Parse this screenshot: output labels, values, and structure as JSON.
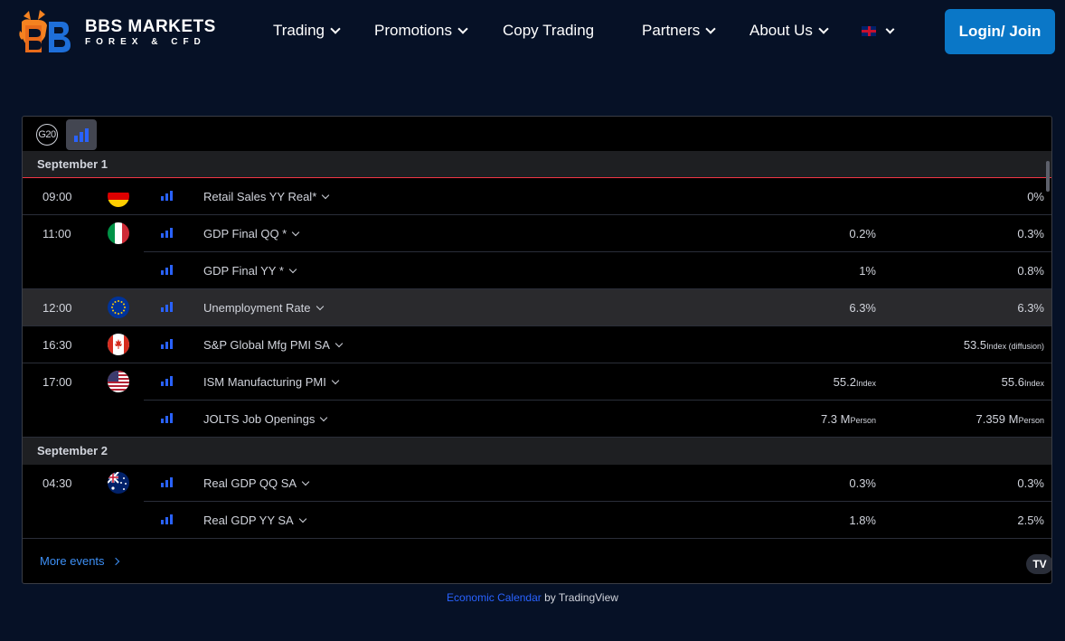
{
  "header": {
    "logo_title": "BBS MARKETS",
    "logo_subtitle": "FOREX & CFD",
    "nav": [
      {
        "label": "Trading",
        "dropdown": true
      },
      {
        "label": "Promotions",
        "dropdown": true
      },
      {
        "label": "Copy Trading",
        "dropdown": false
      },
      {
        "label": "Partners",
        "dropdown": true
      },
      {
        "label": "About Us",
        "dropdown": true
      }
    ],
    "language_icon": "uk-flag-icon",
    "login_label": "Login/ Join"
  },
  "widget": {
    "g20_label": "G20",
    "days": [
      {
        "date": "September 1",
        "events": [
          {
            "time": "09:00",
            "country": "germany",
            "title": "Retail Sales YY Real*",
            "forecast": "",
            "forecast_unit": "",
            "prior": "0%",
            "prior_unit": ""
          },
          {
            "time": "11:00",
            "country": "italy",
            "title": "GDP Final QQ *",
            "forecast": "0.2%",
            "forecast_unit": "",
            "prior": "0.3%",
            "prior_unit": ""
          },
          {
            "time": "",
            "country": "",
            "title": "GDP Final YY *",
            "forecast": "1%",
            "forecast_unit": "",
            "prior": "0.8%",
            "prior_unit": ""
          },
          {
            "time": "12:00",
            "country": "eu",
            "title": "Unemployment Rate",
            "forecast": "6.3%",
            "forecast_unit": "",
            "prior": "6.3%",
            "prior_unit": "",
            "highlight": true
          },
          {
            "time": "16:30",
            "country": "canada",
            "title": "S&P Global Mfg PMI SA",
            "forecast": "",
            "forecast_unit": "",
            "prior": "53.5",
            "prior_unit": "Index (diffusion)"
          },
          {
            "time": "17:00",
            "country": "usa",
            "title": "ISM Manufacturing PMI",
            "forecast": "55.2",
            "forecast_unit": "Index",
            "prior": "55.6",
            "prior_unit": "Index"
          },
          {
            "time": "",
            "country": "",
            "title": "JOLTS Job Openings",
            "forecast": "7.3 M",
            "forecast_unit": "Person",
            "prior": "7.359 M",
            "prior_unit": "Person"
          }
        ]
      },
      {
        "date": "September 2",
        "events": [
          {
            "time": "04:30",
            "country": "australia",
            "title": "Real GDP QQ SA",
            "forecast": "0.3%",
            "forecast_unit": "",
            "prior": "0.3%",
            "prior_unit": ""
          },
          {
            "time": "",
            "country": "",
            "title": "Real GDP YY SA",
            "forecast": "1.8%",
            "forecast_unit": "",
            "prior": "2.5%",
            "prior_unit": ""
          }
        ]
      }
    ],
    "more_events_label": "More events",
    "tv_logo": "TV"
  },
  "footer": {
    "link_label": "Economic Calendar",
    "suffix": " by TradingView"
  },
  "colors": {
    "background": "#061126",
    "login_button": "#0a77c7",
    "importance_bar": "#2962ff",
    "today_line": "#f23645",
    "link": "#3d8ff5"
  }
}
